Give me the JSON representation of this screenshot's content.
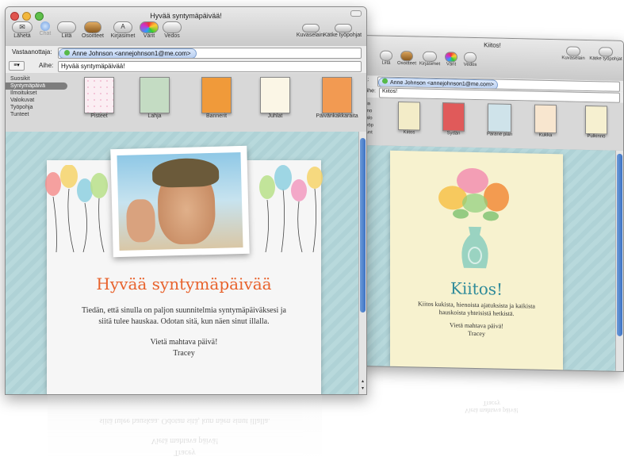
{
  "main_window": {
    "title": "Hyvää syntymäpäivää!",
    "toolbar": {
      "send": "Lähetä",
      "chat": "Chat",
      "attach": "Liitä",
      "addresses": "Osoitteet",
      "fonts": "Kirjasimet",
      "colors": "Värit",
      "draft": "Vedos",
      "photo_browser": "Kuvaselain",
      "hide_stationery": "Kätke työpohjat"
    },
    "to_label": "Vastaanottaja:",
    "to_value": "Anne Johnson <annejohnson1@me.com>",
    "subject_label": "Aihe:",
    "subject_value": "Hyvää syntymäpäivää!",
    "categories": [
      "Suosikit",
      "Syntymäpäivä",
      "Ilmoitukset",
      "Valokuvat",
      "Työpohja",
      "Tunteet"
    ],
    "selected_category": "Syntymäpäivä",
    "stationery": [
      "Pisteet",
      "Lahja",
      "Bannerit",
      "Juhlat",
      "Päivänkakkaraita"
    ],
    "card": {
      "heading": "Hyvää syntymäpäivää",
      "body_line1": "Tiedän, että sinulla on paljon suunnitelmia syntymäpäiväksesi ja",
      "body_line2": "siitä tulee hauskaa. Odotan sitä, kun näen sinut illalla.",
      "closing": "Vietä mahtava päivä!",
      "signature": "Tracey"
    },
    "reflection": {
      "line1": "siitä tulee hauskaa. Odotan sitä, kun näen sinut illalla.",
      "line2": "Vietä mahtava päivä!",
      "line3": "Tracey"
    }
  },
  "back_window": {
    "title": "Kiitos!",
    "toolbar": {
      "attach": "Liitä",
      "addresses": "Osoitteet",
      "fonts": "Kirjasimet",
      "colors": "Värit",
      "draft": "Vedos",
      "photo_browser": "Kuvaselain",
      "hide_stationery": "Kätke työpohjat"
    },
    "to_label": "ja:",
    "to_value": "Anne Johnson <annejohnson1@me.com>",
    "subject_label": "Aihe:",
    "subject_value": "Kiitos!",
    "categories": [
      "ikia",
      "Ilmo",
      "Valo",
      "Työp",
      "Tunt"
    ],
    "stationery": [
      "Kiitos",
      "Sydän",
      "Parane pian",
      "Kukka",
      "Pulkinno"
    ],
    "card": {
      "heading": "Kiitos!",
      "body_line1": "Kiitos kukista, hienoista ajatuksista ja kaikista",
      "body_line2": "hauskoista yhteisistä hetkistä.",
      "closing": "Vietä mahtava päivä!",
      "signature": "Tracey"
    },
    "reflection": {
      "line1": "Vietä mahtava päivä!",
      "line2": "Tracey"
    }
  },
  "colors": {
    "heading_orange": "#e8622c",
    "heading_teal": "#2f8b9a",
    "selection_gray": "#7d7d7d",
    "scroll_blue": "#3d73c4"
  }
}
